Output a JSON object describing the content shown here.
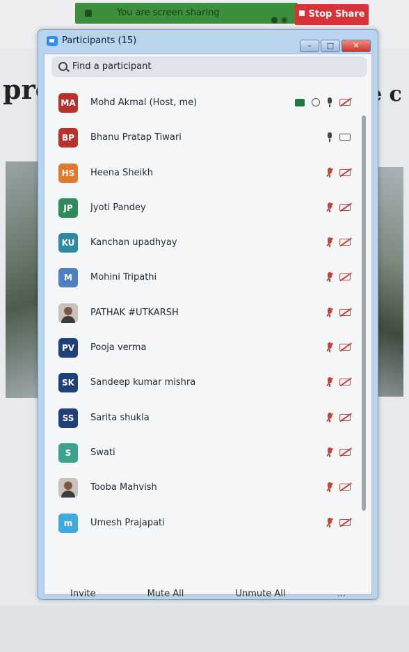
{
  "sharing_bar": {
    "status": "You are screen sharing",
    "stop_label": "Stop Share"
  },
  "background": {
    "left_text": "pro",
    "right_text": "e c"
  },
  "window": {
    "title": "Participants (15)",
    "min": "–",
    "max": "□",
    "close": "✕"
  },
  "search": {
    "placeholder": "Find a participant"
  },
  "participants": [
    {
      "initials": "MA",
      "name": "Mohd Akmal (Host, me)",
      "color": "#b8322c",
      "sharing": true,
      "recording": true,
      "mic": "on",
      "video": "off"
    },
    {
      "initials": "BP",
      "name": "Bhanu Pratap Tiwari",
      "color": "#b8322c",
      "mic": "on",
      "video": "on"
    },
    {
      "initials": "HS",
      "name": "Heena Sheikh",
      "color": "#e07a2c",
      "mic": "muted",
      "video": "off"
    },
    {
      "initials": "JP",
      "name": "Jyoti Pandey",
      "color": "#2f8a5b",
      "mic": "muted",
      "video": "off"
    },
    {
      "initials": "KU",
      "name": "Kanchan upadhyay",
      "color": "#2c8ba3",
      "mic": "muted",
      "video": "off"
    },
    {
      "initials": "M",
      "name": "Mohini Tripathi",
      "color": "#4f7fc2",
      "mic": "muted",
      "video": "off"
    },
    {
      "initials": "",
      "name": "PATHAK #UTKARSH",
      "color": "photo",
      "mic": "muted",
      "video": "off"
    },
    {
      "initials": "PV",
      "name": "Pooja verma",
      "color": "#1f3f7a",
      "mic": "muted",
      "video": "off"
    },
    {
      "initials": "SK",
      "name": "Sandeep kumar mishra",
      "color": "#1f3f7a",
      "mic": "muted",
      "video": "off"
    },
    {
      "initials": "SS",
      "name": "Sarita shukla",
      "color": "#1f3f7a",
      "mic": "muted",
      "video": "off"
    },
    {
      "initials": "S",
      "name": "Swati",
      "color": "#3aa38f",
      "mic": "muted",
      "video": "off"
    },
    {
      "initials": "",
      "name": "Tooba Mahvish",
      "color": "photo",
      "mic": "muted",
      "video": "off"
    },
    {
      "initials": "m",
      "name": "Umesh Prajapati",
      "color": "#3fa9e0",
      "mic": "muted",
      "video": "off"
    }
  ],
  "footer": {
    "invite": "Invite",
    "mute_all": "Mute All",
    "unmute_all": "Unmute All",
    "more": "..."
  }
}
